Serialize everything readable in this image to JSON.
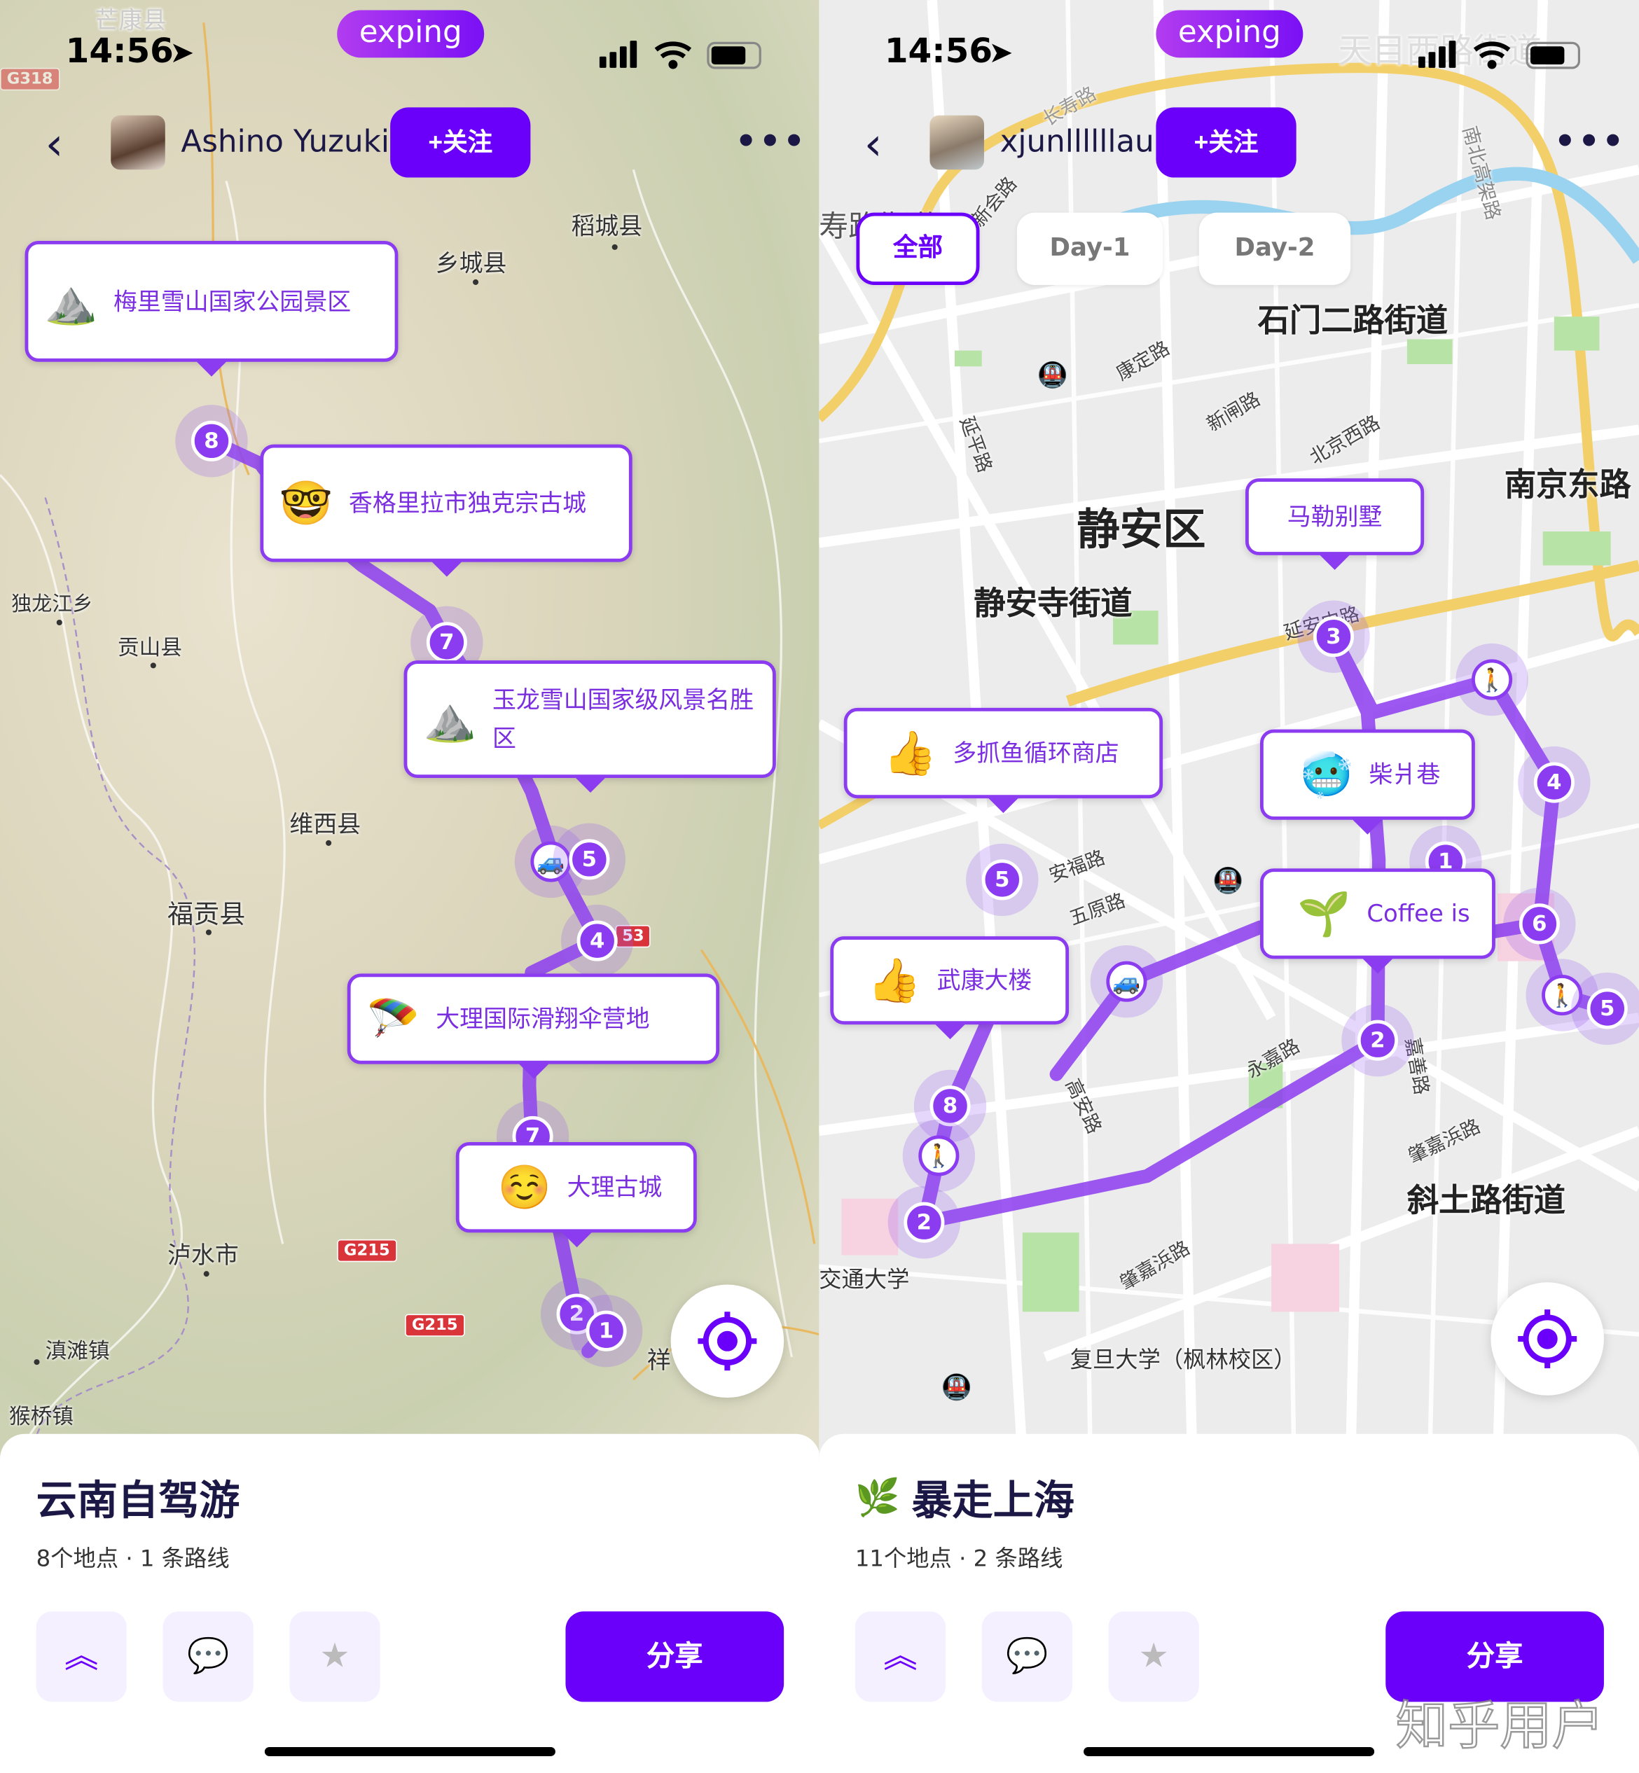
{
  "status_bar": {
    "time": "14:56",
    "app_logo": "exping",
    "icons": [
      "location-arrow-icon",
      "signal-icon",
      "wifi-icon",
      "battery-icon"
    ]
  },
  "colors": {
    "accent": "#6a00fa",
    "route": "#8c3cf0",
    "title": "#1b1846"
  },
  "left": {
    "user": {
      "name": "Ashino Yuzuki",
      "follow_label": "+关注"
    },
    "map_places": {
      "p1": "稻城县",
      "p2": "乡城县",
      "p3": "独龙江乡",
      "p4": "贡山县",
      "p5": "维西县",
      "p6": "福贡县",
      "p7": "泸水市",
      "p8": "滇滩镇",
      "p9": "猴桥镇",
      "p10": "祥",
      "p11": "芒康县"
    },
    "road_badges": [
      "G318",
      "G215",
      "G215",
      "53"
    ],
    "cards": [
      {
        "icon": "⛰️",
        "name": "梅里雪山国家公园景区"
      },
      {
        "icon": "🤓",
        "name": "香格里拉市独克宗古城"
      },
      {
        "icon": "⛰️",
        "name": "玉龙雪山国家级风景名胜区"
      },
      {
        "icon": "🪂",
        "name": "大理国际滑翔伞营地"
      },
      {
        "icon": "☺️",
        "name": "大理古城"
      }
    ],
    "markers": [
      "8",
      "7",
      "5",
      "4",
      "7",
      "2",
      "1"
    ],
    "trip": {
      "title": "云南自驾游",
      "summary": "8个地点 · 1 条路线",
      "share_label": "分享"
    }
  },
  "right": {
    "user": {
      "name": "xjunllllllau",
      "follow_label": "+关注"
    },
    "tabs": [
      "全部",
      "Day-1",
      "Day-2"
    ],
    "active_tab": "全部",
    "map_places": {
      "p1": "石门二路街道",
      "p2": "静安区",
      "p3": "静安寺街道",
      "p4": "南京东路",
      "p5": "斜土路街道",
      "p6": "交通大学",
      "p7": "复旦大学（枫林校区）",
      "p8": "天目西路街道",
      "r1": "长寿路",
      "r2": "新会路",
      "r3": "康定路",
      "r4": "新闸路",
      "r5": "北京西路",
      "r6": "延平路",
      "r7": "安福路",
      "r8": "五原路",
      "r9": "永嘉路",
      "r10": "嘉善路",
      "r11": "肇嘉浜路",
      "r12": "肇嘉浜路",
      "r13": "高安路",
      "r14": "南北高架路",
      "r15": "延安中路",
      "r16": "寿路街道"
    },
    "cards": [
      {
        "icon": "",
        "name": "马勒别墅"
      },
      {
        "icon": "👍",
        "name": "多抓鱼循环商店"
      },
      {
        "icon": "🥶",
        "name": "柴爿巷"
      },
      {
        "icon": "🌱",
        "name": "Coffee is"
      },
      {
        "icon": "👍",
        "name": "武康大楼"
      }
    ],
    "markers": [
      "3",
      "4",
      "5",
      "6",
      "5",
      "2",
      "8",
      "2",
      "1"
    ],
    "trip": {
      "icon": "🌿",
      "title": "暴走上海",
      "summary": "11个地点 · 2 条路线",
      "share_label": "分享"
    }
  },
  "watermark": "知乎用户"
}
